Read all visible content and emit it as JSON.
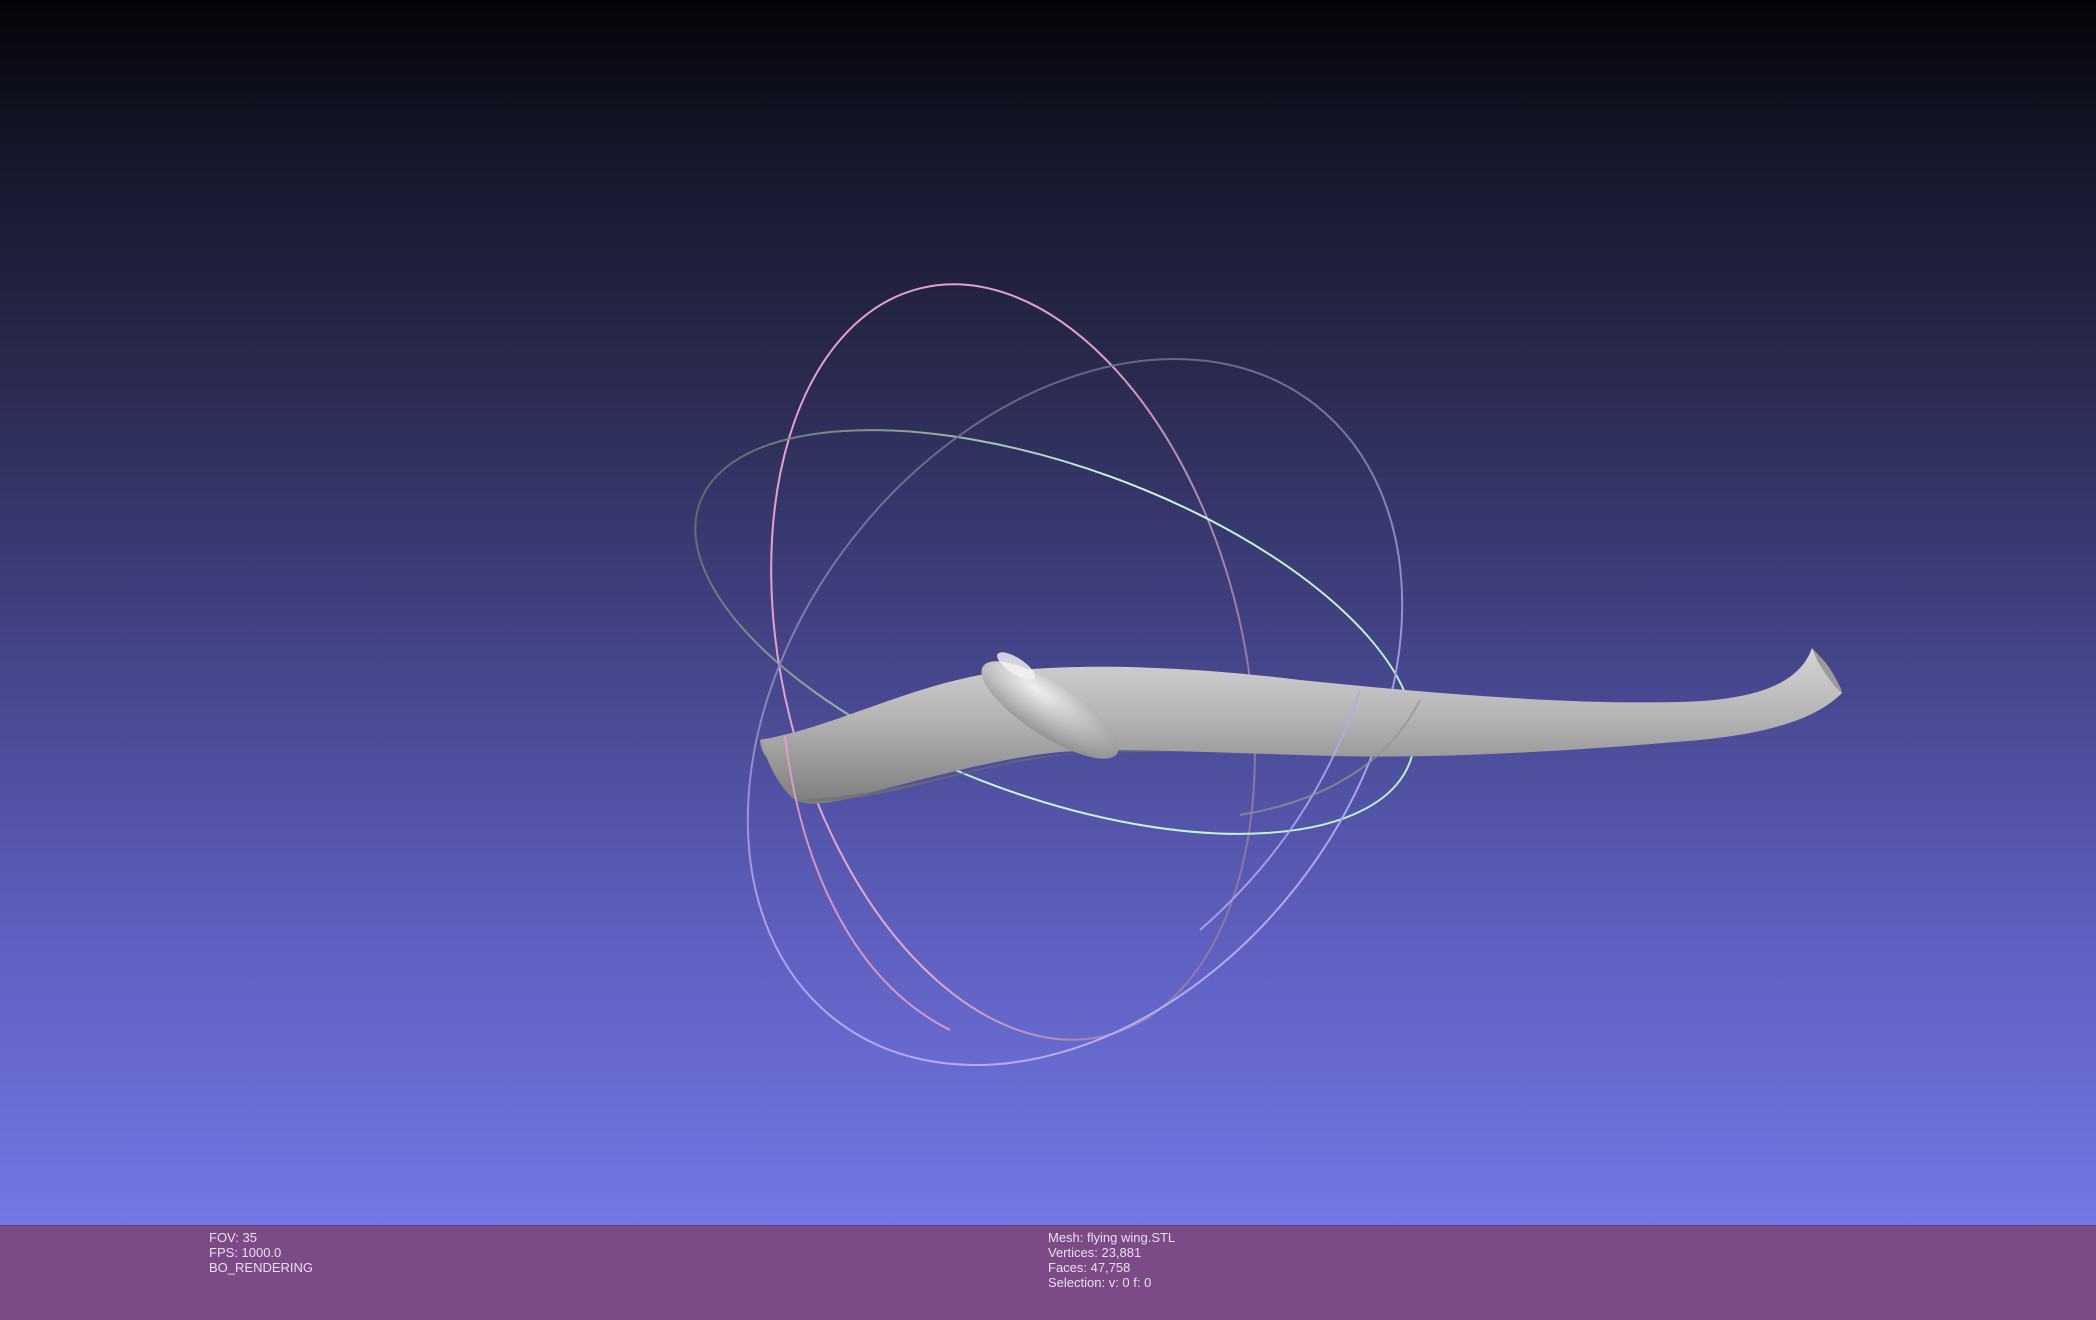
{
  "viewport": {
    "background_top": "#040408",
    "background_bottom": "#7377e7",
    "model_color": "#b4b4b4",
    "trackball_colors": {
      "x_ring": "#e8a0c8",
      "y_ring": "#b8f0c8",
      "z_ring": "#c0b8f8"
    }
  },
  "status_bar": {
    "background": "#7c4a87",
    "left_info": {
      "fov": "FOV: 35",
      "fps": "FPS:  1000.0",
      "mode": "BO_RENDERING"
    },
    "mesh_info": {
      "mesh": "Mesh: flying wing.STL",
      "vertices": "Vertices: 23,881",
      "faces": "Faces: 47,758",
      "selection": "Selection: v: 0 f: 0"
    }
  }
}
